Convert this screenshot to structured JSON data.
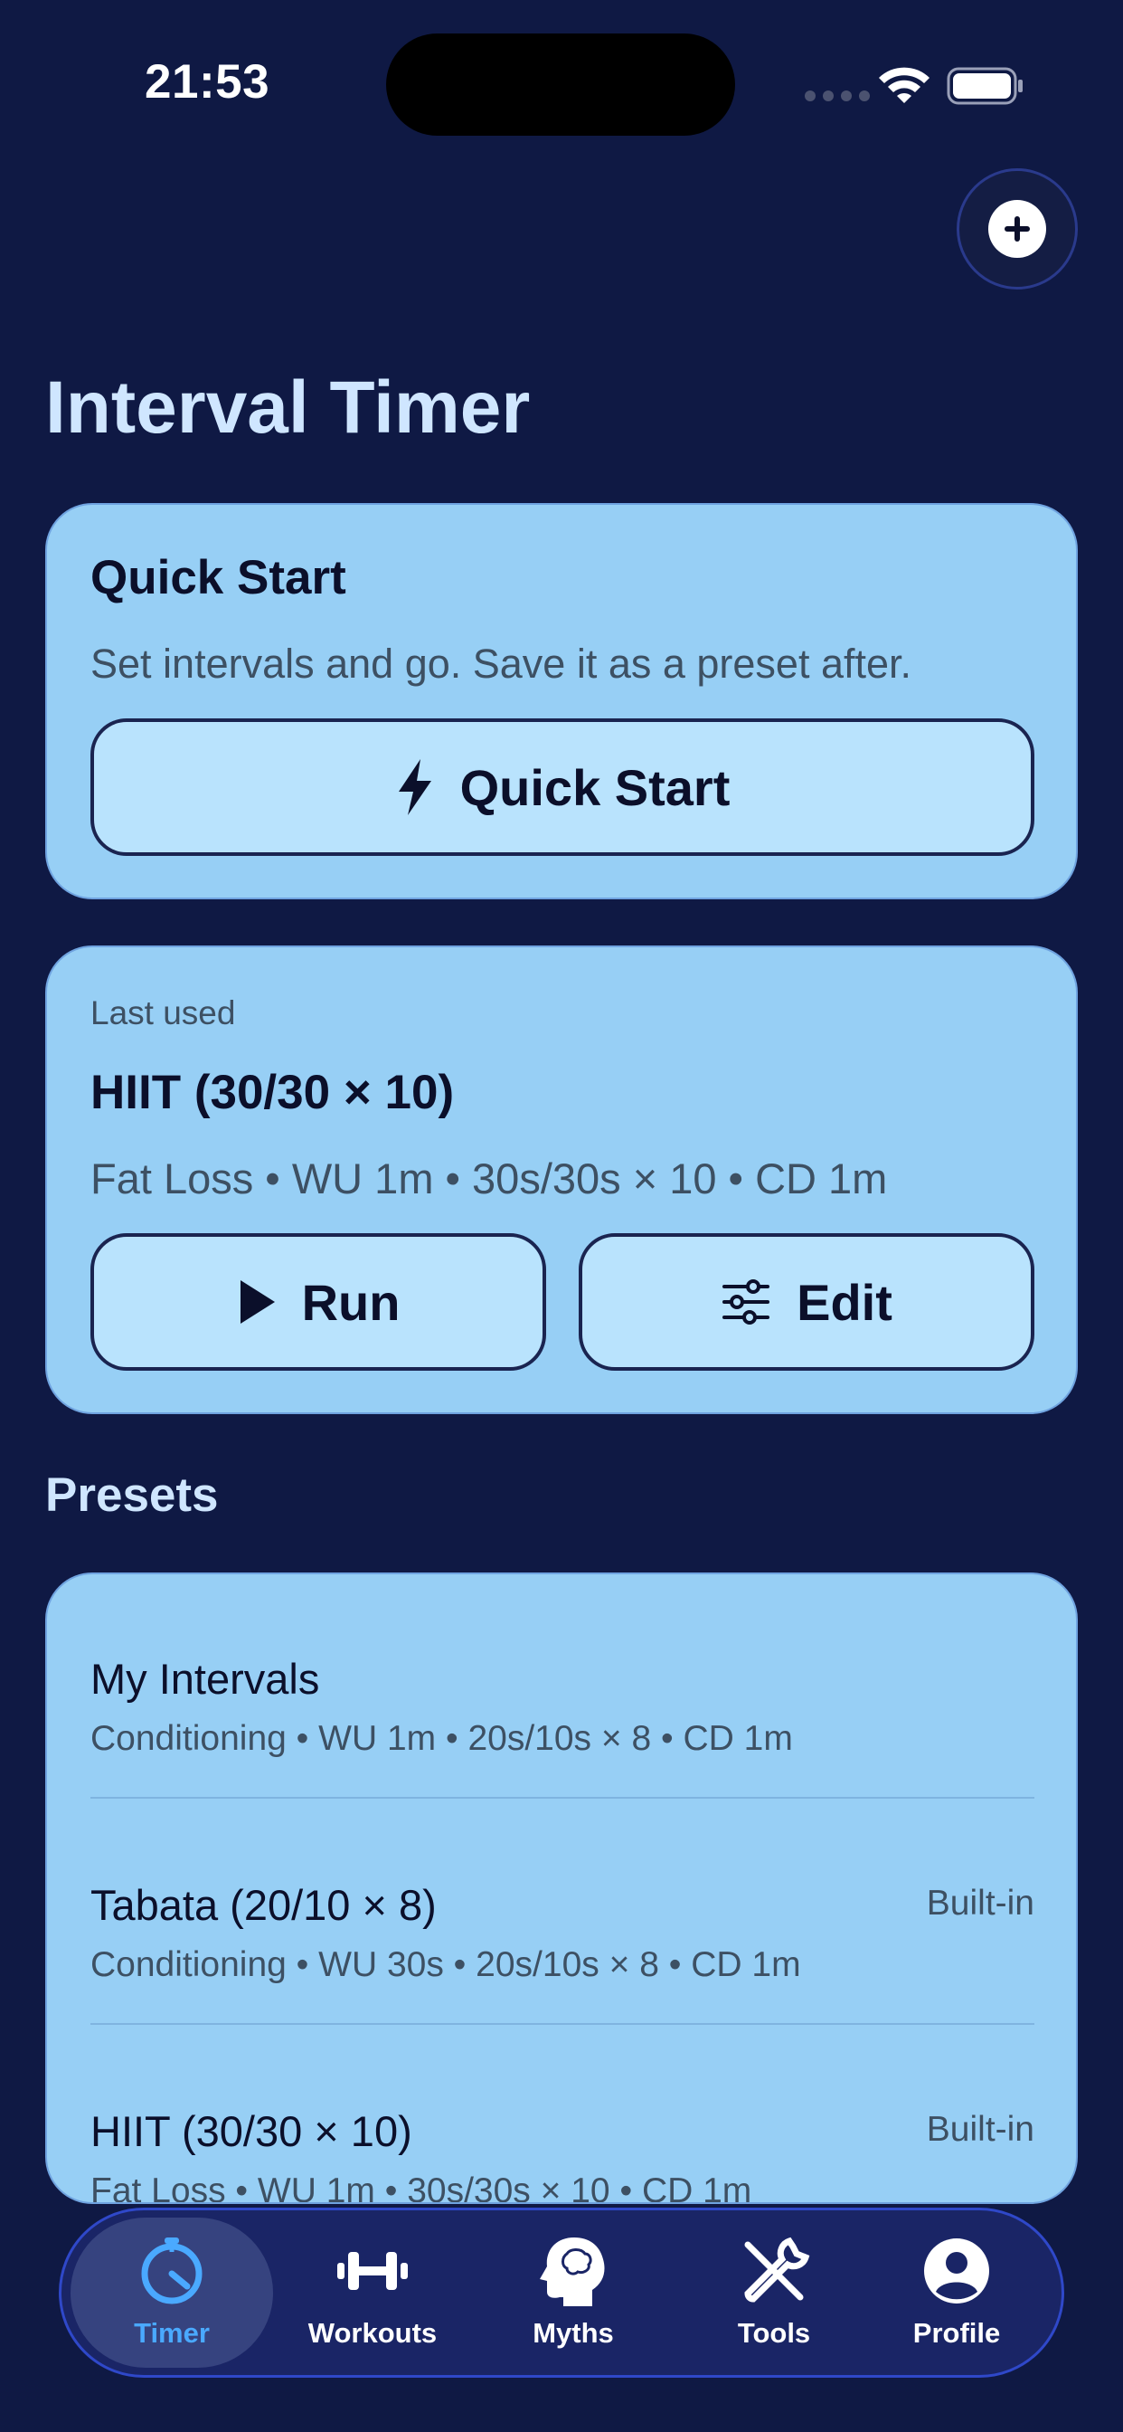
{
  "status_bar": {
    "time": "21:53"
  },
  "header": {
    "title": "Interval Timer"
  },
  "quick_start_card": {
    "title": "Quick Start",
    "subtitle": "Set intervals and go. Save it as a preset after.",
    "button_label": "Quick Start"
  },
  "last_used_card": {
    "label": "Last used",
    "title": "HIIT (30/30 × 10)",
    "details": "Fat Loss • WU 1m • 30s/30s × 10 • CD 1m",
    "run_label": "Run",
    "edit_label": "Edit"
  },
  "presets": {
    "section_title": "Presets",
    "items": [
      {
        "name": "My Intervals",
        "details": "Conditioning • WU 1m • 20s/10s × 8 • CD 1m",
        "tag": ""
      },
      {
        "name": "Tabata (20/10 × 8)",
        "details": "Conditioning • WU 30s • 20s/10s × 8 • CD 1m",
        "tag": "Built-in"
      },
      {
        "name": "HIIT (30/30 × 10)",
        "details": "Fat Loss • WU 1m • 30s/30s × 10 • CD 1m",
        "tag": "Built-in"
      }
    ]
  },
  "tab_bar": {
    "active": "Timer",
    "accent_color": "#4aa9ff",
    "items": [
      {
        "label": "Timer",
        "icon": "timer-icon"
      },
      {
        "label": "Workouts",
        "icon": "dumbbell-icon"
      },
      {
        "label": "Myths",
        "icon": "brain-head-icon"
      },
      {
        "label": "Tools",
        "icon": "tools-icon"
      },
      {
        "label": "Profile",
        "icon": "profile-icon"
      }
    ]
  }
}
